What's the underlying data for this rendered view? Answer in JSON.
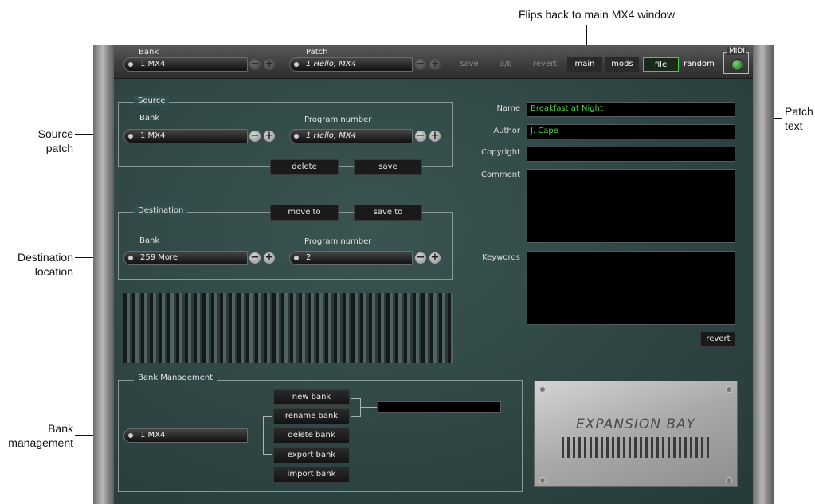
{
  "callouts": {
    "flip_main": "Flips back to main MX4 window",
    "source_patch": [
      "Source",
      "patch"
    ],
    "dest_location": [
      "Destination",
      "location"
    ],
    "bank_mgmt": [
      "Bank",
      "management"
    ],
    "patch_text": [
      "Patch",
      "text"
    ]
  },
  "toolbar": {
    "bank_label": "Bank",
    "bank_value": "1 MX4",
    "patch_label": "Patch",
    "patch_value": "1 Hello, MX4",
    "save": "save",
    "ab": "a/b",
    "revert": "revert",
    "main": "main",
    "mods": "mods",
    "file": "file",
    "random": "random",
    "midi": "MIDI"
  },
  "source": {
    "title": "Source",
    "bank_label": "Bank",
    "bank_value": "1 MX4",
    "program_label": "Program number",
    "program_value": "1 Hello, MX4",
    "delete": "delete",
    "save": "save"
  },
  "destination": {
    "title": "Destination",
    "move_to": "move to",
    "save_to": "save to",
    "bank_label": "Bank",
    "bank_value": "259 More",
    "program_label": "Program number",
    "program_value": "2"
  },
  "patch_info": {
    "name_label": "Name",
    "name_value": "Breakfast at Night",
    "author_label": "Author",
    "author_value": "J. Cape",
    "copyright_label": "Copyright",
    "copyright_value": "",
    "comment_label": "Comment",
    "comment_value": "",
    "keywords_label": "Keywords",
    "keywords_value": "",
    "revert": "revert"
  },
  "bank_management": {
    "title": "Bank Management",
    "bank_value": "1 MX4",
    "new_bank": "new bank",
    "rename_bank": "rename bank",
    "delete_bank": "delete bank",
    "export_bank": "export bank",
    "import_bank": "import bank",
    "name_field": ""
  },
  "expansion": {
    "title": "EXPANSION BAY"
  }
}
